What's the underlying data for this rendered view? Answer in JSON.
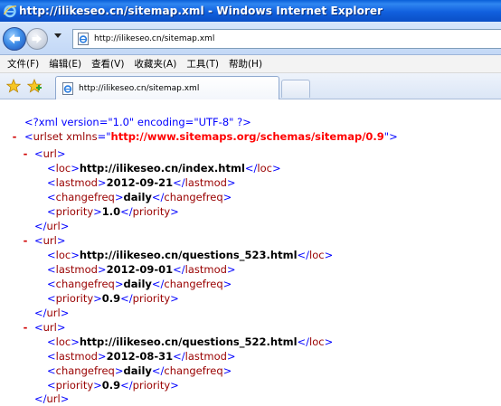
{
  "window": {
    "title": "http://ilikeseo.cn/sitemap.xml - Windows Internet Explorer"
  },
  "address_bar": {
    "url": "http://ilikeseo.cn/sitemap.xml"
  },
  "menu": {
    "items": [
      "文件(F)",
      "编辑(E)",
      "查看(V)",
      "收藏夹(A)",
      "工具(T)",
      "帮助(H)"
    ]
  },
  "tabs": [
    {
      "label": "http://ilikeseo.cn/sitemap.xml"
    }
  ],
  "xml": {
    "declaration": "<?xml version=\"1.0\" encoding=\"UTF-8\" ?>",
    "collapse_marker": "-",
    "urlset": {
      "tag": "urlset",
      "attr_name": "xmlns",
      "attr_value": "http://www.sitemaps.org/schemas/sitemap/0.9"
    },
    "entries": [
      {
        "loc": "http://ilikeseo.cn/index.html",
        "lastmod": "2012-09-21",
        "changefreq": "daily",
        "priority": "1.0"
      },
      {
        "loc": "http://ilikeseo.cn/questions_523.html",
        "lastmod": "2012-09-01",
        "changefreq": "daily",
        "priority": "0.9"
      },
      {
        "loc": "http://ilikeseo.cn/questions_522.html",
        "lastmod": "2012-08-31",
        "changefreq": "daily",
        "priority": "0.9"
      }
    ],
    "tags": {
      "url": "url",
      "loc": "loc",
      "lastmod": "lastmod",
      "changefreq": "changefreq",
      "priority": "priority"
    }
  },
  "colors": {
    "titlebar": "#1160de",
    "xml_bracket": "#0000ff",
    "xml_tag": "#990000",
    "xml_attr_value": "#ff0000",
    "collapse_marker": "#d00000"
  }
}
